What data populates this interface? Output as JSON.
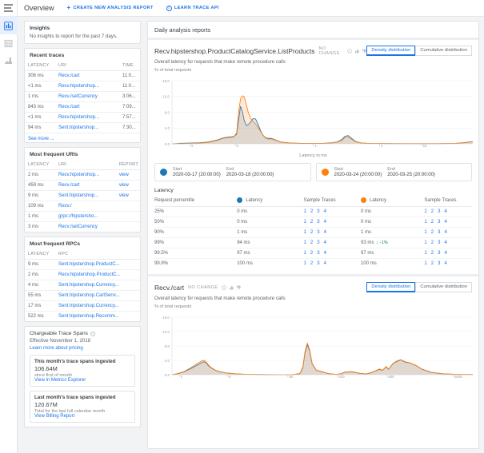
{
  "colors": {
    "blue": "#1a73e8",
    "series_blue": "#1f77b4",
    "series_orange": "#ff7f0e",
    "green": "#188038",
    "muted": "#80868b"
  },
  "rail": {
    "menu_icon": "hamburger-icon",
    "items": [
      {
        "name": "analysis-reports",
        "icon": "analysis-reports-icon",
        "active": true
      },
      {
        "name": "trace-list",
        "icon": "trace-list-icon",
        "active": false
      },
      {
        "name": "trace-analytics",
        "icon": "trace-analytics-icon",
        "active": false
      }
    ]
  },
  "header": {
    "title": "Overview",
    "create_report_label": "CREATE NEW ANALYSIS REPORT",
    "learn_api_label": "LEARN TRACE API"
  },
  "insights": {
    "title": "Insights",
    "body": "No insights to report for the past 7 days."
  },
  "recent_traces": {
    "title": "Recent traces",
    "columns": [
      "LATENCY",
      "URI",
      "TIME"
    ],
    "rows": [
      {
        "latency": "306 ms",
        "uri": "Recv./cart",
        "time": "11:0..."
      },
      {
        "latency": "<1 ms",
        "uri": "Recv.hipstershop...",
        "time": "11:0..."
      },
      {
        "latency": "1 ms",
        "uri": "Recv./setCurrency",
        "time": "3:06..."
      },
      {
        "latency": "843 ms",
        "uri": "Recv./cart",
        "time": "7:09..."
      },
      {
        "latency": "<1 ms",
        "uri": "Recv.hipstershop...",
        "time": "7:57..."
      },
      {
        "latency": "94 ms",
        "uri": "Sent.hipstershop...",
        "time": "7:30..."
      }
    ],
    "see_more": "See more ..."
  },
  "frequent_uris": {
    "title": "Most frequent URIs",
    "columns": [
      "LATENCY",
      "URI",
      "REPORT"
    ],
    "rows": [
      {
        "latency": "2 ms",
        "uri": "Recv.hipstershop...",
        "report": "view"
      },
      {
        "latency": "459 ms",
        "uri": "Recv./cart",
        "report": "view"
      },
      {
        "latency": "9 ms",
        "uri": "Sent.hipstershop...",
        "report": "view"
      },
      {
        "latency": "109 ms",
        "uri": "Recv./",
        "report": ""
      },
      {
        "latency": "1 ms",
        "uri": "grpc://hipstersho...",
        "report": ""
      },
      {
        "latency": "3 ms",
        "uri": "Recv./setCurrency",
        "report": ""
      }
    ]
  },
  "frequent_rpcs": {
    "title": "Most frequent RPCs",
    "columns": [
      "LATENCY",
      "RPC"
    ],
    "rows": [
      {
        "latency": "9 ms",
        "rpc": "Sent.hipstershop.ProductC..."
      },
      {
        "latency": "2 ms",
        "rpc": "Recv.hipstershop.ProductC..."
      },
      {
        "latency": "4 ms",
        "rpc": "Sent.hipstershop.Currency..."
      },
      {
        "latency": "55 ms",
        "rpc": "Sent.hipstershop.CartServi..."
      },
      {
        "latency": "17 ms",
        "rpc": "Sent.hipstershop.Currency..."
      },
      {
        "latency": "522 ms",
        "rpc": "Sent.hipstershop.Recomm..."
      }
    ]
  },
  "chargeable": {
    "title": "Chargeable Trace Spans",
    "effective": "Effective November 1, 2018",
    "learn_link": "Learn more about pricing",
    "this_month": {
      "heading": "This month's trace spans ingested",
      "value": "106.64M",
      "sub": "since first of month",
      "link": "View in Metrics Explorer"
    },
    "last_month": {
      "heading": "Last month's trace spans ingested",
      "value": "120.67M",
      "sub": "Total for the last full calendar month",
      "link": "View Billing Report"
    }
  },
  "main": {
    "panel_title": "Daily analysis reports",
    "reports": [
      {
        "name": "Recv.hipstershop.ProductCatalogService.ListProducts",
        "status": "NO CHANGE",
        "icons": [
          "info-icon",
          "thumbs-up-icon",
          "thumbs-down-icon"
        ],
        "tabs": [
          {
            "label": "Density distribution",
            "selected": true
          },
          {
            "label": "Cumulative distribution",
            "selected": false
          }
        ],
        "description": "Overall latency for requests that make remote procedure calls",
        "yaxis_label": "% of total requests",
        "xaxis_label": "Latency in ms",
        "ranges": [
          {
            "series": "blue",
            "start_label": "Start",
            "start": "2020-03-17 (20:00:00)",
            "end_label": "End",
            "end": "2020-03-18 (20:00:00)"
          },
          {
            "series": "orange",
            "start_label": "Start",
            "start": "2020-03-24 (20:00:00)",
            "end_label": "End",
            "end": "2020-03-25 (20:00:00)"
          }
        ],
        "latency_section": {
          "title": "Latency",
          "columns": [
            "Request percentile",
            "Latency",
            "Sample Traces",
            "Latency",
            "Sample Traces"
          ],
          "traces": [
            "1",
            "2",
            "3",
            "4"
          ],
          "rows": [
            {
              "percentile": "25%",
              "a": "0 ms",
              "b": "0 ms",
              "delta": ""
            },
            {
              "percentile": "50%",
              "a": "0 ms",
              "b": "0 ms",
              "delta": ""
            },
            {
              "percentile": "90%",
              "a": "1 ms",
              "b": "1 ms",
              "delta": ""
            },
            {
              "percentile": "99%",
              "a": "94 ms",
              "b": "93 ms",
              "delta": "-1%"
            },
            {
              "percentile": "99.5%",
              "a": "97 ms",
              "b": "97 ms",
              "delta": ""
            },
            {
              "percentile": "99.9%",
              "a": "100 ms",
              "b": "100 ms",
              "delta": ""
            }
          ]
        }
      },
      {
        "name": "Recv./cart",
        "status": "NO CHANGE",
        "icons": [
          "info-icon",
          "thumbs-up-icon",
          "thumbs-down-icon"
        ],
        "tabs": [
          {
            "label": "Density distribution",
            "selected": true
          },
          {
            "label": "Cumulative distribution",
            "selected": false
          }
        ],
        "description": "Overall latency for requests that make remote procedure calls",
        "yaxis_label": "% of total requests",
        "xaxis_label": ""
      }
    ]
  },
  "chart_data": [
    {
      "type": "area",
      "title": "Recv.hipstershop.ProductCatalogService.ListProducts",
      "xlabel": "Latency in ms",
      "ylabel": "% of total requests",
      "ylim": [
        0,
        16
      ],
      "yticks": [
        "0.0",
        "4.0",
        "8.0",
        "12.0",
        "16.0"
      ],
      "xticks": [
        "9",
        "0",
        "1",
        "4",
        "10"
      ],
      "xtick_positions": [
        0.06,
        0.21,
        0.47,
        0.69,
        0.83
      ],
      "grid": true,
      "legend": "none",
      "series": [
        {
          "name": "2020-03-17 (20:00:00) – 2020-03-18 (20:00:00)",
          "color": "#1f77b4",
          "x": [
            0.0,
            0.03,
            0.06,
            0.09,
            0.12,
            0.15,
            0.17,
            0.19,
            0.205,
            0.215,
            0.222,
            0.228,
            0.234,
            0.24,
            0.247,
            0.254,
            0.262,
            0.27,
            0.278,
            0.286,
            0.294,
            0.302,
            0.31,
            0.32,
            0.33,
            0.345,
            0.36,
            0.38,
            0.4,
            0.43,
            0.47,
            0.5,
            0.53,
            0.55,
            0.565,
            0.575,
            0.585,
            0.595,
            0.61,
            0.63,
            0.66,
            0.72,
            0.8,
            0.88,
            0.94,
            0.97,
            0.99,
            1.0
          ],
          "y": [
            0.0,
            0.15,
            0.2,
            0.25,
            0.45,
            0.95,
            1.5,
            1.75,
            1.85,
            2.4,
            6.5,
            9.5,
            8.2,
            6.0,
            4.6,
            4.9,
            5.6,
            6.4,
            6.3,
            5.0,
            3.4,
            2.2,
            1.6,
            1.35,
            1.4,
            0.95,
            0.5,
            0.3,
            0.2,
            0.12,
            0.1,
            0.12,
            0.25,
            0.5,
            1.1,
            1.9,
            2.1,
            1.5,
            0.6,
            0.2,
            0.1,
            0.06,
            0.05,
            0.05,
            0.1,
            0.3,
            0.5,
            0.55
          ]
        },
        {
          "name": "2020-03-24 (20:00:00) – 2020-03-25 (20:00:00)",
          "color": "#ff7f0e",
          "x": [
            0.0,
            0.03,
            0.06,
            0.09,
            0.12,
            0.15,
            0.17,
            0.19,
            0.205,
            0.215,
            0.222,
            0.228,
            0.234,
            0.24,
            0.247,
            0.254,
            0.262,
            0.27,
            0.278,
            0.286,
            0.294,
            0.302,
            0.31,
            0.32,
            0.33,
            0.345,
            0.36,
            0.38,
            0.4,
            0.43,
            0.47,
            0.5,
            0.53,
            0.55,
            0.565,
            0.575,
            0.585,
            0.595,
            0.61,
            0.63,
            0.66,
            0.72,
            0.8,
            0.88,
            0.94,
            0.97,
            0.99,
            1.0
          ],
          "y": [
            0.0,
            0.05,
            0.1,
            0.15,
            0.35,
            0.85,
            1.4,
            1.6,
            1.7,
            2.8,
            8.5,
            11.4,
            12.2,
            11.9,
            10.0,
            7.8,
            6.4,
            5.6,
            5.0,
            4.2,
            3.2,
            2.2,
            1.5,
            1.2,
            1.25,
            0.9,
            0.45,
            0.25,
            0.18,
            0.1,
            0.08,
            0.1,
            0.2,
            0.45,
            0.9,
            1.6,
            1.8,
            1.3,
            0.5,
            0.18,
            0.08,
            0.05,
            0.05,
            0.05,
            0.08,
            0.25,
            0.45,
            0.5
          ]
        }
      ]
    },
    {
      "type": "area",
      "title": "Recv./cart",
      "xlabel": "",
      "ylabel": "% of total requests",
      "ylim": [
        0,
        16
      ],
      "yticks": [
        "0.0",
        "4.0",
        "8.0",
        "12.0",
        "16.0"
      ],
      "xticks": [
        "2",
        "8",
        "50",
        "200",
        "800",
        "5000"
      ],
      "xtick_positions": [
        0.025,
        0.185,
        0.385,
        0.55,
        0.715,
        0.935
      ],
      "grid": true,
      "legend": "none",
      "series": [
        {
          "name": "2020-03-17 (20:00:00) – 2020-03-18 (20:00:00)",
          "color": "#1f77b4",
          "x": [
            0.0,
            0.02,
            0.04,
            0.06,
            0.08,
            0.1,
            0.105,
            0.11,
            0.115,
            0.12,
            0.13,
            0.145,
            0.16,
            0.18,
            0.21,
            0.25,
            0.3,
            0.35,
            0.4,
            0.425,
            0.435,
            0.442,
            0.45,
            0.458,
            0.466,
            0.48,
            0.5,
            0.52,
            0.545,
            0.56,
            0.575,
            0.6,
            0.625,
            0.645,
            0.66,
            0.675,
            0.69,
            0.7,
            0.712,
            0.72,
            0.735,
            0.745,
            0.76,
            0.775,
            0.79,
            0.81,
            0.83,
            0.86,
            0.9,
            0.95,
            1.0
          ],
          "y": [
            0.0,
            0.3,
            0.8,
            1.6,
            2.5,
            3.4,
            3.6,
            3.5,
            3.2,
            2.6,
            1.9,
            1.2,
            0.8,
            0.5,
            0.25,
            0.1,
            0.05,
            0.03,
            0.02,
            0.3,
            2.0,
            6.0,
            8.4,
            6.5,
            3.0,
            1.2,
            0.8,
            0.3,
            0.1,
            0.2,
            0.7,
            0.8,
            0.35,
            0.2,
            0.5,
            1.0,
            1.5,
            1.2,
            2.2,
            1.5,
            3.1,
            3.6,
            4.1,
            3.5,
            3.3,
            2.6,
            1.6,
            0.7,
            0.25,
            0.1,
            0.05
          ]
        },
        {
          "name": "2020-03-24 (20:00:00) – 2020-03-25 (20:00:00)",
          "color": "#ff7f0e",
          "x": [
            0.0,
            0.02,
            0.04,
            0.06,
            0.08,
            0.1,
            0.105,
            0.11,
            0.115,
            0.12,
            0.13,
            0.145,
            0.16,
            0.18,
            0.21,
            0.25,
            0.3,
            0.35,
            0.4,
            0.425,
            0.435,
            0.442,
            0.45,
            0.458,
            0.466,
            0.48,
            0.5,
            0.52,
            0.545,
            0.56,
            0.575,
            0.6,
            0.625,
            0.645,
            0.66,
            0.675,
            0.69,
            0.7,
            0.712,
            0.72,
            0.735,
            0.745,
            0.76,
            0.775,
            0.79,
            0.81,
            0.83,
            0.86,
            0.9,
            0.95,
            1.0
          ],
          "y": [
            0.0,
            0.35,
            0.9,
            1.8,
            2.9,
            3.9,
            4.0,
            3.8,
            3.4,
            2.8,
            2.0,
            1.25,
            0.85,
            0.5,
            0.25,
            0.1,
            0.05,
            0.03,
            0.02,
            0.35,
            2.2,
            6.4,
            8.8,
            6.8,
            3.1,
            1.25,
            0.85,
            0.32,
            0.1,
            0.22,
            0.75,
            0.85,
            0.38,
            0.22,
            0.55,
            1.05,
            1.6,
            1.25,
            2.3,
            1.55,
            3.2,
            3.7,
            4.2,
            3.6,
            3.35,
            2.65,
            1.55,
            0.65,
            0.22,
            0.09,
            0.04
          ]
        }
      ]
    }
  ]
}
